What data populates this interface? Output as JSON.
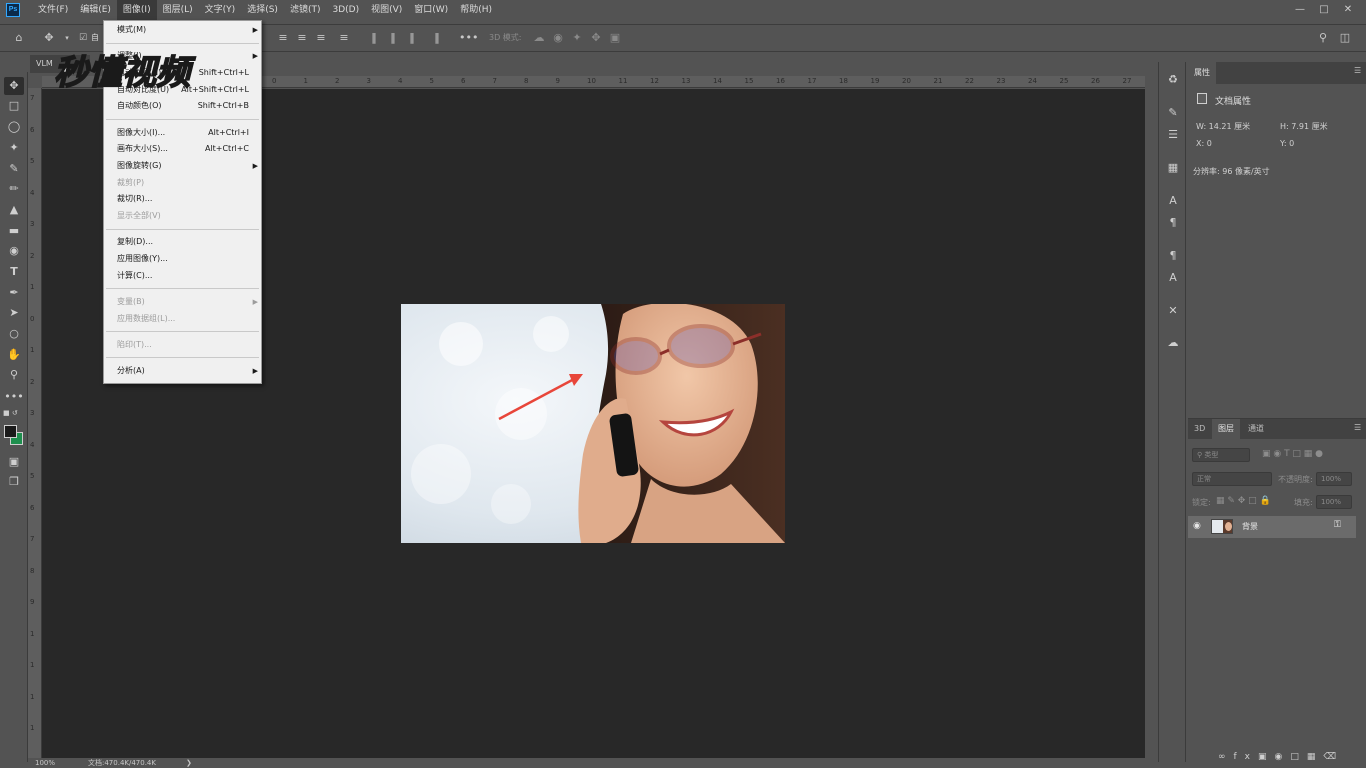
{
  "menubar": {
    "items": [
      "文件(F)",
      "编辑(E)",
      "图像(I)",
      "图层(L)",
      "文字(Y)",
      "选择(S)",
      "滤镜(T)",
      "3D(D)",
      "视图(V)",
      "窗口(W)",
      "帮助(H)"
    ],
    "logo": "Ps"
  },
  "optbar": {
    "autoselect_label": "自",
    "mode3d_label": "3D 模式:"
  },
  "doctab": {
    "label": "VLM"
  },
  "image_menu": {
    "items": [
      {
        "label": "模式(M)",
        "shortcut": "",
        "submenu": true,
        "disabled": false
      },
      {
        "label": "调整(J)",
        "shortcut": "",
        "submenu": true,
        "disabled": false
      },
      {
        "label": "自动色调(N)",
        "shortcut": "Shift+Ctrl+L",
        "submenu": false,
        "disabled": false
      },
      {
        "label": "自动对比度(U)",
        "shortcut": "Alt+Shift+Ctrl+L",
        "submenu": false,
        "disabled": false
      },
      {
        "label": "自动颜色(O)",
        "shortcut": "Shift+Ctrl+B",
        "submenu": false,
        "disabled": false
      },
      {
        "label": "图像大小(I)...",
        "shortcut": "Alt+Ctrl+I",
        "submenu": false,
        "disabled": false
      },
      {
        "label": "画布大小(S)...",
        "shortcut": "Alt+Ctrl+C",
        "submenu": false,
        "disabled": false
      },
      {
        "label": "图像旋转(G)",
        "shortcut": "",
        "submenu": true,
        "disabled": false
      },
      {
        "label": "裁剪(P)",
        "shortcut": "",
        "submenu": false,
        "disabled": true
      },
      {
        "label": "裁切(R)...",
        "shortcut": "",
        "submenu": false,
        "disabled": false
      },
      {
        "label": "显示全部(V)",
        "shortcut": "",
        "submenu": false,
        "disabled": true
      },
      {
        "label": "复制(D)...",
        "shortcut": "",
        "submenu": false,
        "disabled": false
      },
      {
        "label": "应用图像(Y)...",
        "shortcut": "",
        "submenu": false,
        "disabled": false
      },
      {
        "label": "计算(C)...",
        "shortcut": "",
        "submenu": false,
        "disabled": false
      },
      {
        "label": "变量(B)",
        "shortcut": "",
        "submenu": true,
        "disabled": true
      },
      {
        "label": "应用数据组(L)...",
        "shortcut": "",
        "submenu": false,
        "disabled": true
      },
      {
        "label": "陷印(T)...",
        "shortcut": "",
        "submenu": false,
        "disabled": true
      },
      {
        "label": "分析(A)",
        "shortcut": "",
        "submenu": true,
        "disabled": false
      }
    ]
  },
  "watermark": {
    "text": "秒懂视频"
  },
  "ruler": {
    "top_ticks": [
      "0",
      "1",
      "2",
      "3",
      "4",
      "5",
      "6",
      "7",
      "8",
      "9",
      "10",
      "11",
      "12",
      "13",
      "14",
      "15",
      "16",
      "17",
      "18",
      "19",
      "20",
      "21",
      "22",
      "23",
      "24",
      "25",
      "26",
      "27"
    ],
    "left_ticks": [
      "7",
      "6",
      "5",
      "4",
      "3",
      "2",
      "1",
      "0",
      "1",
      "2",
      "3",
      "4",
      "5",
      "6",
      "7",
      "8",
      "9",
      "1",
      "1",
      "1",
      "1"
    ]
  },
  "status": {
    "zoom": "100%",
    "doc": "文档:470.4K/470.4K"
  },
  "properties": {
    "tab": "属性",
    "section": "文档属性",
    "w": "W:  14.21 厘米",
    "h": "H:  7.91 厘米",
    "x": "X:  0",
    "y": "Y:  0",
    "resolution": "分辨率: 96 像素/英寸"
  },
  "layers": {
    "tabs": [
      "3D",
      "图层",
      "通道"
    ],
    "filter_placeholder": "类型",
    "blend_mode": "正常",
    "opacity_label": "不透明度:",
    "opacity_value": "100%",
    "lock_label": "锁定:",
    "fill_label": "填充:",
    "fill_value": "100%",
    "layer_name": "背景"
  },
  "colors": {
    "foreground": "#1a1a1a",
    "background": "#1e8f4e",
    "accent": "#31a8ff"
  }
}
